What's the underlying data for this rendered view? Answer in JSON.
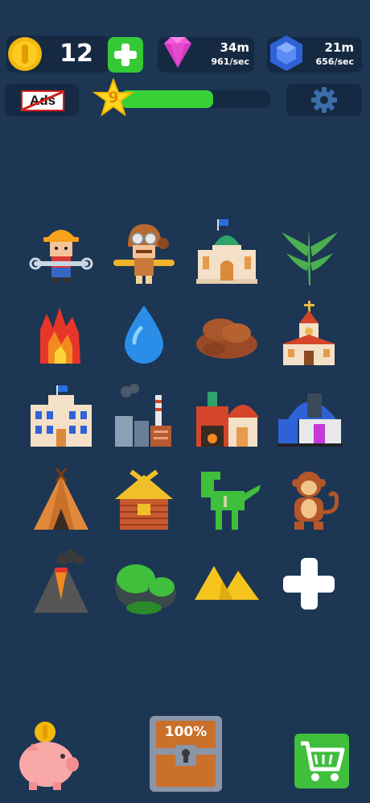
{
  "colors": {
    "background": "#1c3654",
    "tile_teal": "#1b5a66",
    "tile_blue": "#233f5c",
    "level_bar": "#37d136",
    "add_button": "#35c935",
    "cart_button": "#3fbf3c"
  },
  "top_bar": {
    "coins": {
      "icon": "gold-coin-icon",
      "value": "12",
      "add_icon": "plus-icon"
    },
    "gems": {
      "icon": "pink-diamond-icon",
      "amount": "34m",
      "rate": "961/sec"
    },
    "sapphires": {
      "icon": "blue-sapphire-icon",
      "amount": "21m",
      "rate": "656/sec"
    }
  },
  "second_bar": {
    "ads_label": "Ads",
    "level": {
      "number": "9",
      "progress": 0.62,
      "icon": "star-icon"
    },
    "settings_icon": "gear-icon"
  },
  "grid": {
    "tiles": [
      {
        "name": "builder-worker",
        "bg": "teal"
      },
      {
        "name": "pilot",
        "bg": "teal"
      },
      {
        "name": "domed-hall",
        "bg": "blue"
      },
      {
        "name": "fern-plant",
        "bg": "teal"
      },
      {
        "name": "fire",
        "bg": "teal"
      },
      {
        "name": "water-drop",
        "bg": "blue"
      },
      {
        "name": "mud-pile",
        "bg": "teal"
      },
      {
        "name": "chapel",
        "bg": "blue"
      },
      {
        "name": "school-building",
        "bg": "blue"
      },
      {
        "name": "factory",
        "bg": "teal"
      },
      {
        "name": "forge-workshop",
        "bg": "blue"
      },
      {
        "name": "observatory-lab",
        "bg": "teal"
      },
      {
        "name": "tepee",
        "bg": "teal"
      },
      {
        "name": "log-cabin",
        "bg": "blue"
      },
      {
        "name": "dinosaur",
        "bg": "teal"
      },
      {
        "name": "monkey",
        "bg": "blue"
      },
      {
        "name": "volcano",
        "bg": "blue"
      },
      {
        "name": "mossy-rocks",
        "bg": "teal"
      },
      {
        "name": "sand-dunes",
        "bg": "blue"
      },
      {
        "name": "add-slot",
        "bg": "plus"
      }
    ]
  },
  "bottom_bar": {
    "piggy_bank_icon": "piggy-bank-icon",
    "chest_label": "100%",
    "chest_icon": "treasure-chest-icon",
    "cart_icon": "shopping-cart-icon"
  }
}
